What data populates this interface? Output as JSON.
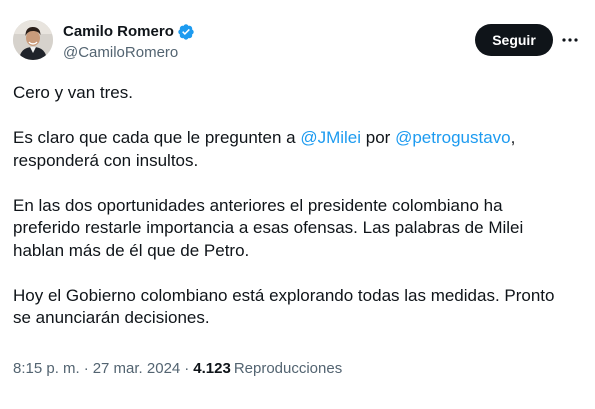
{
  "author": {
    "display_name": "Camilo Romero",
    "handle": "@CamiloRomero",
    "verified": true
  },
  "actions": {
    "follow_label": "Seguir"
  },
  "tweet": {
    "p1": "Cero y van tres.",
    "p2_a": "Es claro que cada que le pregunten a ",
    "p2_mention1": "@JMilei",
    "p2_b": " por ",
    "p2_mention2": "@petrogustavo",
    "p2_c": ",",
    "p2_line2": "responderá con insultos.",
    "p3_line1": "En las dos oportunidades anteriores el presidente colombiano ha",
    "p3_line2": "preferido restarle importancia a esas ofensas. Las palabras de Milei",
    "p3_line3": "hablan más de él que de Petro.",
    "p4_line1": "Hoy el Gobierno colombiano está explorando todas las medidas. Pronto",
    "p4_line2": "se anunciarán decisiones."
  },
  "meta": {
    "time": "8:15 p. m.",
    "separator": "·",
    "date": "27 mar. 2024",
    "views_count": "4.123",
    "views_label": "Reproducciones"
  },
  "colors": {
    "link": "#1d9bf0",
    "secondary_text": "#536471",
    "primary_text": "#0f1419",
    "verified_badge": "#1d9bf0"
  },
  "icons": {
    "verified": "verified-badge-icon",
    "more": "more-dots-icon"
  }
}
